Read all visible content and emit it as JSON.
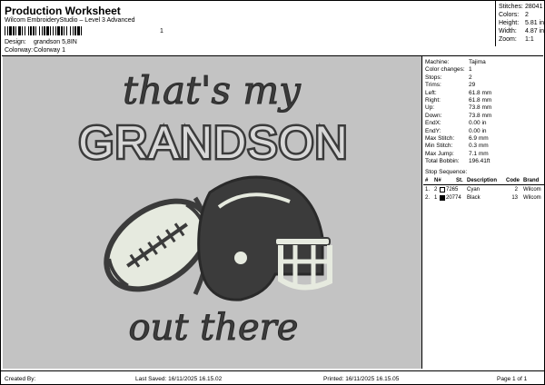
{
  "header": {
    "title": "Production Worksheet",
    "subtitle": "Wilcom EmbroideryStudio – Level 3 Advanced",
    "barcode_label": "1",
    "design_label": "Design:",
    "design_value": "grandson 5,8IN",
    "colorway_label": "Colorway:",
    "colorway_value": "Colorway 1"
  },
  "summary": {
    "stitches_label": "Stitches:",
    "stitches": "28041",
    "colors_label": "Colors:",
    "colors": "2",
    "height_label": "Height:",
    "height": "5.81 in",
    "width_label": "Width:",
    "width": "4.87 in",
    "zoom_label": "Zoom:",
    "zoom": "1:1"
  },
  "design_preview": {
    "line1": "that's my",
    "line2": "GRANDSON",
    "line3": "out there",
    "background": "#c3c3c3",
    "thread_dark": "#3b3b3b",
    "thread_light": "#e6eadf"
  },
  "details": [
    {
      "k": "Machine:",
      "v": "Tajima"
    },
    {
      "k": "Color changes:",
      "v": "1"
    },
    {
      "k": "Stops:",
      "v": "2"
    },
    {
      "k": "Trims:",
      "v": "29"
    },
    {
      "k": "Left:",
      "v": "61.8 mm"
    },
    {
      "k": "Right:",
      "v": "61.8 mm"
    },
    {
      "k": "Up:",
      "v": "73.8 mm"
    },
    {
      "k": "Down:",
      "v": "73.8 mm"
    },
    {
      "k": "EndX:",
      "v": "0.00 in"
    },
    {
      "k": "EndY:",
      "v": "0.00 in"
    },
    {
      "k": "Max Stitch:",
      "v": "6.9 mm"
    },
    {
      "k": "Min Stitch:",
      "v": "0.3 mm"
    },
    {
      "k": "Max Jump:",
      "v": "7.1 mm"
    },
    {
      "k": "Total Bobbin:",
      "v": "196.41ft"
    }
  ],
  "stop_sequence": {
    "title": "Stop Sequence:",
    "headers": {
      "num": "#",
      "n": "N#",
      "st": "St.",
      "desc": "Description",
      "code": "Code",
      "brand": "Brand"
    },
    "rows": [
      {
        "num": "1.",
        "n": "2",
        "st": "7265",
        "desc": "Cyan",
        "code": "2",
        "brand": "Wilcom",
        "swatch": "#ffffff"
      },
      {
        "num": "2.",
        "n": "1",
        "st": "20774",
        "desc": "Black",
        "code": "13",
        "brand": "Wilcom",
        "swatch": "#000000"
      }
    ]
  },
  "footer": {
    "created": "Created By:",
    "saved": "Last Saved: 16/11/2025 16.15.02",
    "printed": "Printed: 16/11/2025 16.15.05",
    "page": "Page 1 of 1"
  }
}
